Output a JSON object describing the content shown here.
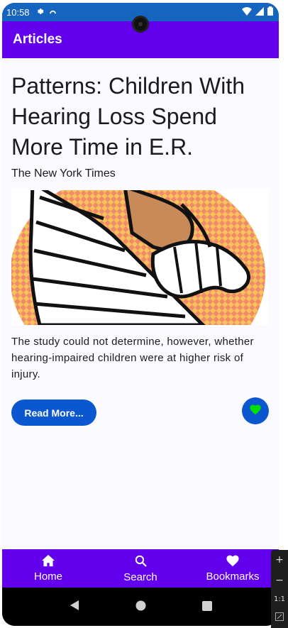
{
  "status_bar": {
    "time": "10:58",
    "settings_icon": "gear-icon",
    "sync_icon": "sync-icon",
    "wifi_icon": "wifi-icon",
    "signal_icon": "signal-icon",
    "battery_icon": "battery-icon",
    "background": "#1565c0"
  },
  "app_bar": {
    "title": "Articles",
    "background": "#6200ee"
  },
  "article": {
    "headline": "Patterns: Children With Hearing Loss Spend More Time in E.R.",
    "source": "The New York Times",
    "image": "cartoon of bandaged child illustration",
    "description": "The study could not determine, however, whether hearing-impaired children were at higher risk of injury.",
    "read_more_label": "Read More...",
    "bookmark_icon": "heart-icon",
    "bookmarked_color": "#00e000",
    "button_color": "#0b57d0"
  },
  "bottom_nav": {
    "items": [
      {
        "label": "Home",
        "icon": "home-icon"
      },
      {
        "label": "Search",
        "icon": "search-icon"
      },
      {
        "label": "Bookmarks",
        "icon": "heart-icon"
      }
    ]
  },
  "emulator_controls": {
    "zoom_in": "+",
    "zoom_out": "−",
    "ratio": "1:1"
  }
}
